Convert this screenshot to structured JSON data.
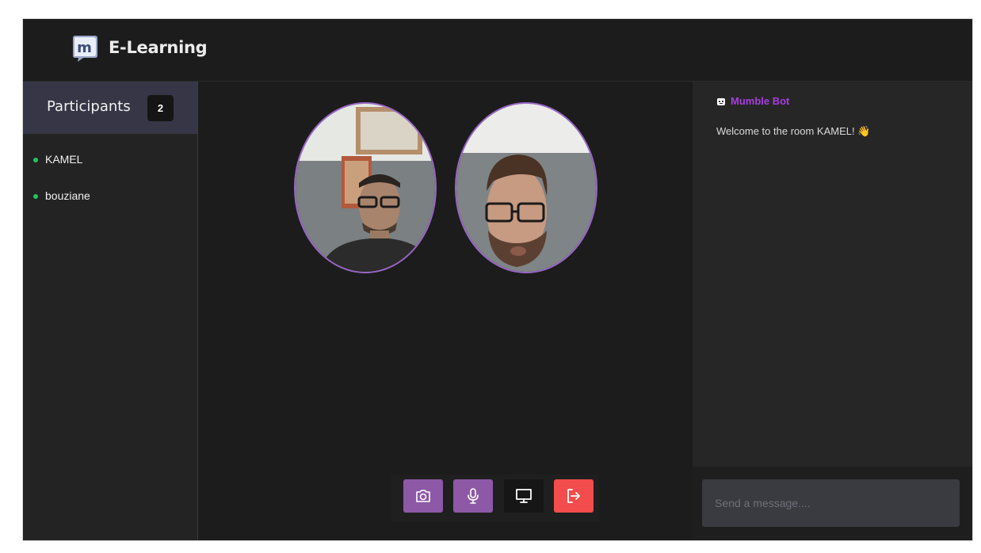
{
  "app": {
    "brand": "E-Learning",
    "logo_letter": "m"
  },
  "sidebar": {
    "title": "Participants",
    "count": "2",
    "participants": [
      {
        "name": "KAMEL",
        "status_color": "#22c55e"
      },
      {
        "name": "bouziane",
        "status_color": "#22c55e"
      }
    ]
  },
  "videos": [
    {
      "participant": "KAMEL"
    },
    {
      "participant": "bouziane"
    }
  ],
  "controls": {
    "camera_icon": "camera-icon",
    "mic_icon": "microphone-icon",
    "screen_icon": "monitor-icon",
    "exit_icon": "exit-icon"
  },
  "chat": {
    "bot_name": "Mumble Bot",
    "welcome": "Welcome to the room KAMEL! 👋",
    "placeholder": "Send a message...."
  },
  "colors": {
    "accent": "#8d58a6",
    "bot_name": "#a83ee0",
    "exit": "#f24c4c",
    "online": "#22c55e",
    "sidebar_header": "#363646"
  }
}
